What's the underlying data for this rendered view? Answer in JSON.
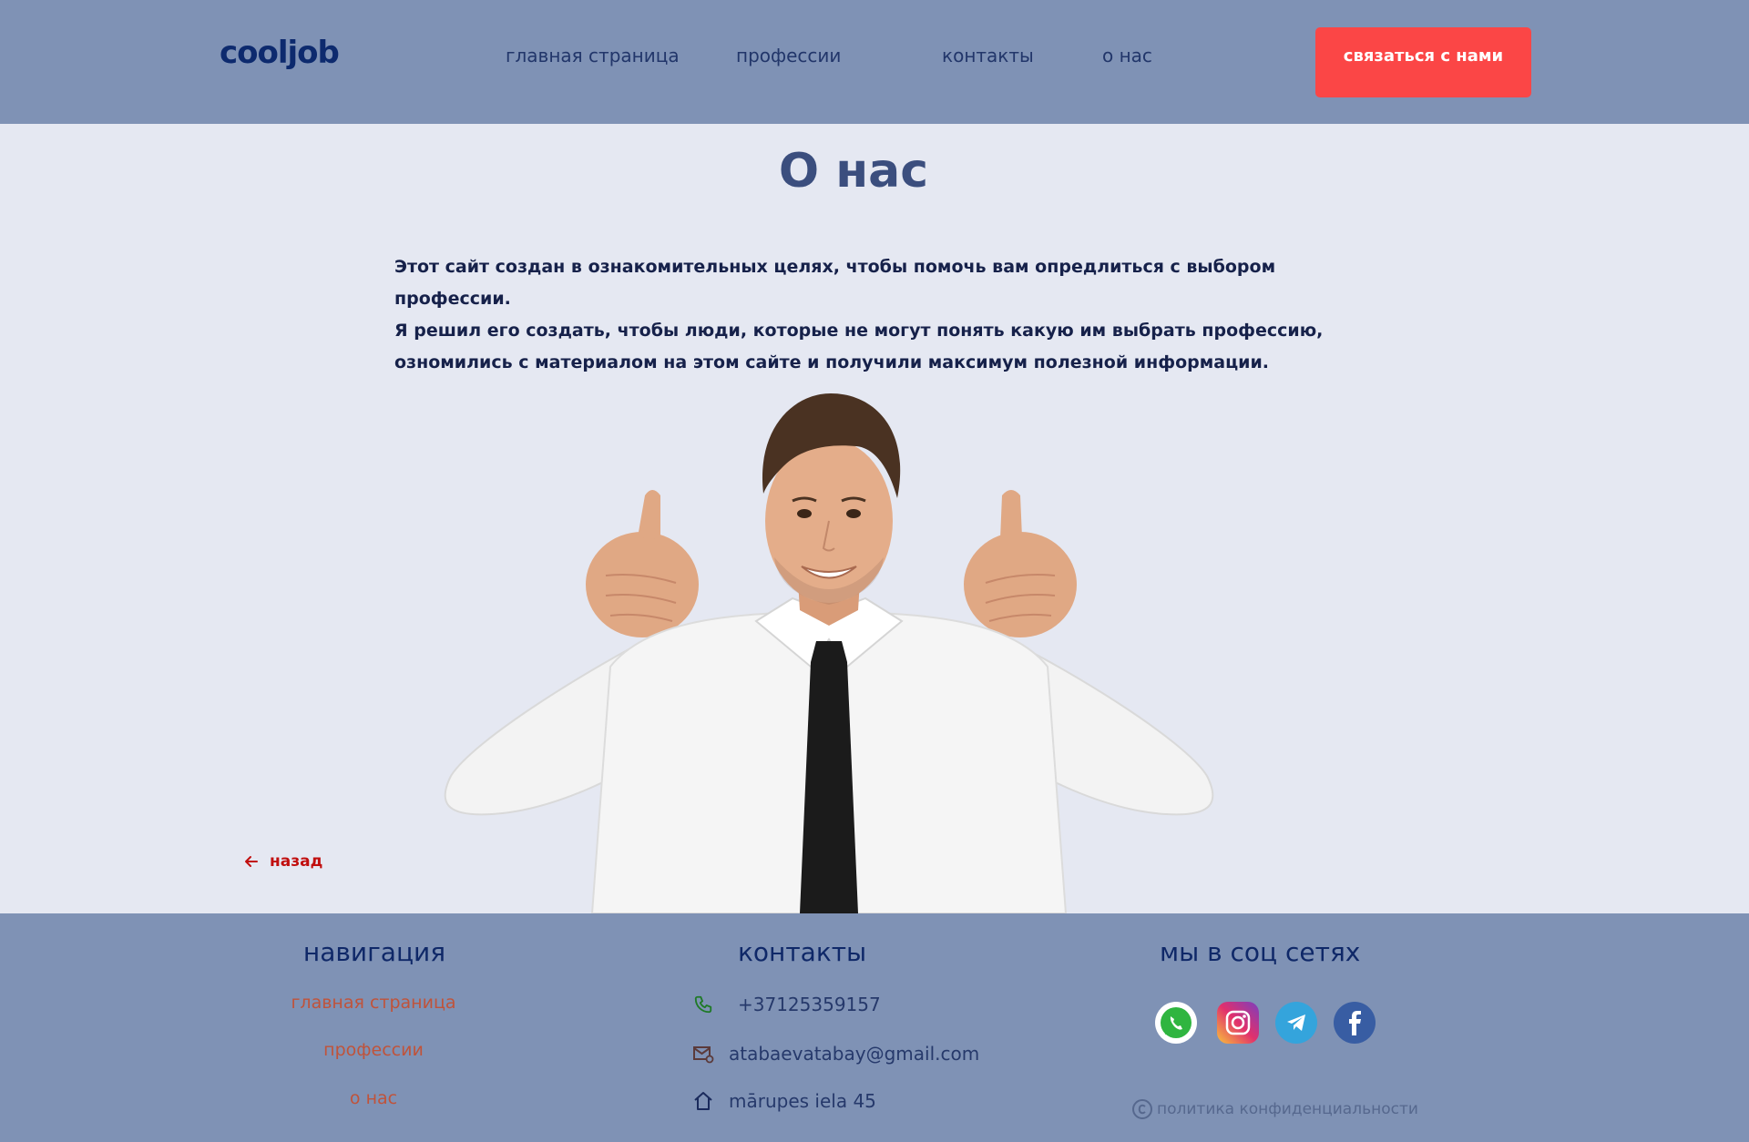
{
  "header": {
    "logo": "cooljob",
    "nav": [
      "главная страница",
      "профессии",
      "контакты",
      "о нас"
    ],
    "cta_label": "связаться с нами"
  },
  "main": {
    "title": "О нас",
    "intro": [
      "Этот сайт создан в ознакомительных целях, чтобы помочь вам опредлиться с выбором профессии.",
      "Я решил его создать, чтобы люди, которые не могут понять какую им выбрать профессию, озномились с материалом на этом сайте и получили максимум полезной информации."
    ],
    "back_label": "назад"
  },
  "footer": {
    "navigation": {
      "title": "навигация",
      "links": [
        "главная страница",
        "профессии",
        "о нас"
      ]
    },
    "contacts": {
      "title": "контакты",
      "phone": "+37125359157",
      "email": "atabaevatabay@gmail.com",
      "address": "mārupes iela 45"
    },
    "social": {
      "title": "мы в соц сетях",
      "networks": [
        "whatsapp",
        "instagram",
        "telegram",
        "facebook"
      ]
    },
    "policy": "политика конфиденциальности"
  },
  "colors": {
    "header_bg": "#7f92b5",
    "page_bg": "#e5e8f2",
    "accent": "#fb4646",
    "logo": "#0d2a6e",
    "back_link": "#c10e0e",
    "footer_link": "#c0533a"
  }
}
